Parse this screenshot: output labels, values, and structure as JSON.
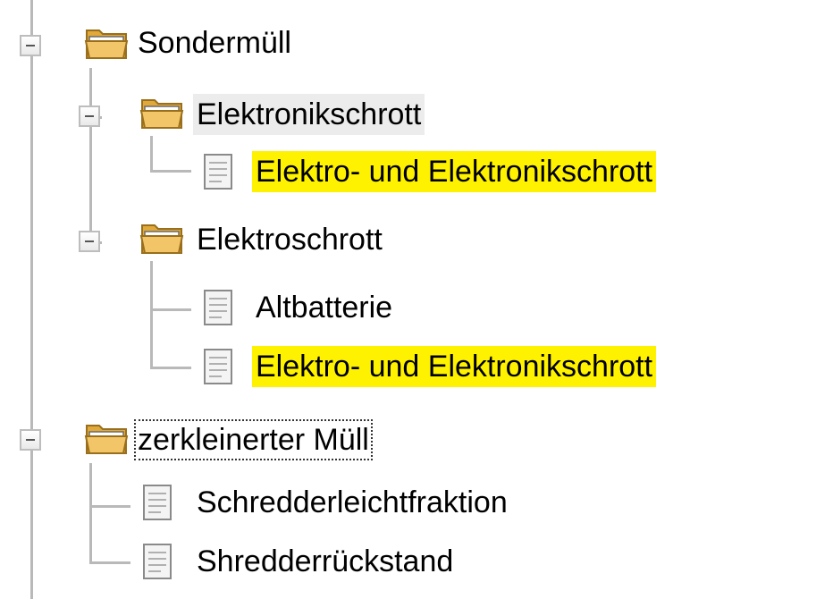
{
  "tree": {
    "nodes": [
      {
        "label": "Sondermüll",
        "type": "folder",
        "level": 0,
        "expanded": true
      },
      {
        "label": "Elektronikschrott",
        "type": "folder",
        "level": 1,
        "expanded": true,
        "selected": true
      },
      {
        "label": "Elektro- und Elektronikschrott",
        "type": "document",
        "level": 2,
        "highlighted": true
      },
      {
        "label": "Elektroschrott",
        "type": "folder",
        "level": 1,
        "expanded": true
      },
      {
        "label": "Altbatterie",
        "type": "document",
        "level": 2
      },
      {
        "label": "Elektro- und Elektronikschrott",
        "type": "document",
        "level": 2,
        "highlighted": true
      },
      {
        "label": "zerkleinerter Müll",
        "type": "folder",
        "level": 0,
        "expanded": true,
        "focused": true
      },
      {
        "label": "Schredderleichtfraktion",
        "type": "document",
        "level": 1
      },
      {
        "label": "Shredderrückstand",
        "type": "document",
        "level": 1
      }
    ]
  },
  "colors": {
    "highlight": "#fff200",
    "selected": "#ececec",
    "connector": "#b9b9b9",
    "folder": "#e8b84a"
  },
  "icons": {
    "folder": "folder-open-icon",
    "document": "document-icon",
    "toggle": "collapse-minus-icon"
  }
}
